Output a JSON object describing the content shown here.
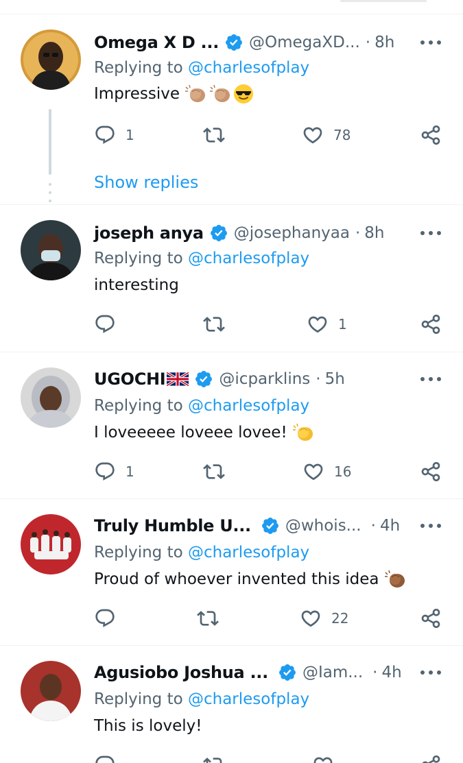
{
  "icons": {
    "reply": "speech-bubble-icon",
    "retweet": "retweet-arrows-icon",
    "like": "heart-icon",
    "share": "share-nodes-icon",
    "more": "three-dots-icon",
    "verified": "blue-verified-badge-icon"
  },
  "colors": {
    "accent": "#1d9bf0",
    "muted": "#536471",
    "text": "#0f1419",
    "divider": "#eff3f4"
  },
  "replying_prefix": "Replying to ",
  "show_replies": "Show replies",
  "tweets": [
    {
      "name": "Omega X D ...",
      "handle": "@OmegaXD...",
      "sep": "·",
      "time": "8h",
      "mention": "@charlesofplay",
      "text": "Impressive",
      "emojis": [
        "clapping-hands-emoji",
        "clapping-hands-emoji",
        "sunglasses-face-emoji"
      ],
      "replies": "1",
      "retweets": "",
      "likes": "78"
    },
    {
      "name": "joseph anya",
      "handle": "@josephanyaa",
      "sep": "·",
      "time": "8h",
      "mention": "@charlesofplay",
      "text": "interesting",
      "emojis": [],
      "replies": "",
      "retweets": "",
      "likes": "1"
    },
    {
      "name": "UGOCHI",
      "flag": "uk-flag-emoji",
      "handle": "@icparklins",
      "sep": "·",
      "time": "5h",
      "mention": "@charlesofplay",
      "text": "I loveeeee loveee lovee!",
      "emojis": [
        "clapping-hands-emoji"
      ],
      "replies": "1",
      "retweets": "",
      "likes": "16"
    },
    {
      "name": "Truly Humble U...",
      "handle": "@whois...",
      "sep": "·",
      "time": "4h",
      "mention": "@charlesofplay",
      "text": "Proud of whoever invented this idea",
      "emojis": [
        "clapping-hands-emoji"
      ],
      "replies": "",
      "retweets": "",
      "likes": "22"
    },
    {
      "name": "Agusiobo Joshua ...",
      "handle": "@Iam...",
      "sep": "·",
      "time": "4h",
      "mention": "@charlesofplay",
      "text": "This is lovely!",
      "emojis": [],
      "replies": "",
      "retweets": "",
      "likes": ""
    }
  ]
}
